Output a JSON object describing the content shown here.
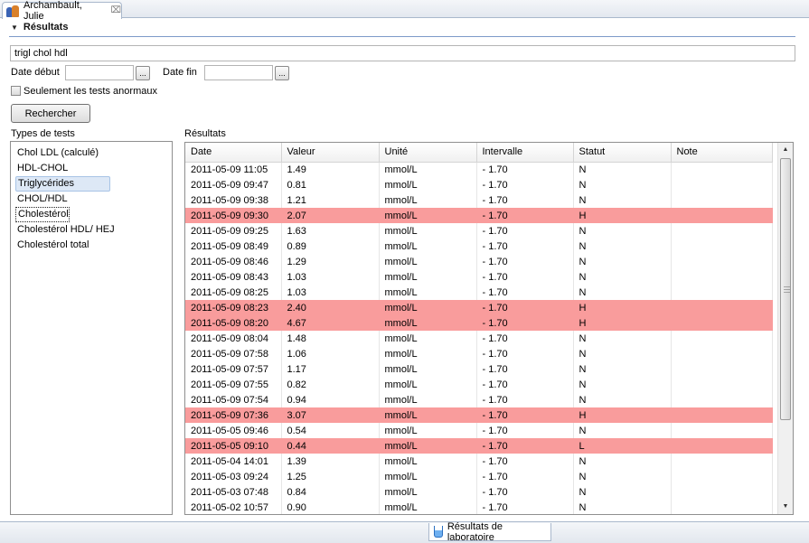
{
  "editor_tab": {
    "title": "Archambault, Julie",
    "close_glyph": "⌧"
  },
  "section": {
    "title": "Résultats"
  },
  "search": {
    "query": "trigl chol hdl",
    "date_start_label": "Date début",
    "date_end_label": "Date fin",
    "date_start_value": "",
    "date_end_value": "",
    "dots_label": "...",
    "abnormal_only_label": "Seulement les tests anormaux",
    "abnormal_only_checked": false,
    "search_button_label": "Rechercher"
  },
  "types": {
    "label": "Types de tests",
    "items": [
      "Chol LDL (calculé)",
      "HDL-CHOL",
      "Triglycérides",
      "CHOL/HDL",
      "Cholestérol",
      "Cholestérol HDL/ HEJ",
      "Cholestérol total"
    ],
    "selected_index": 2,
    "focused_index": 4
  },
  "results": {
    "label": "Résultats",
    "columns": [
      "Date",
      "Valeur",
      "Unité",
      "Intervalle",
      "Statut",
      "Note"
    ],
    "rows": [
      {
        "date": "2011-05-09 11:05",
        "value": "1.49",
        "unit": "mmol/L",
        "range": " - 1.70",
        "status": "N",
        "note": ""
      },
      {
        "date": "2011-05-09 09:47",
        "value": "0.81",
        "unit": "mmol/L",
        "range": " - 1.70",
        "status": "N",
        "note": ""
      },
      {
        "date": "2011-05-09 09:38",
        "value": "1.21",
        "unit": "mmol/L",
        "range": " - 1.70",
        "status": "N",
        "note": ""
      },
      {
        "date": "2011-05-09 09:30",
        "value": "2.07",
        "unit": "mmol/L",
        "range": " - 1.70",
        "status": "H",
        "note": ""
      },
      {
        "date": "2011-05-09 09:25",
        "value": "1.63",
        "unit": "mmol/L",
        "range": " - 1.70",
        "status": "N",
        "note": ""
      },
      {
        "date": "2011-05-09 08:49",
        "value": "0.89",
        "unit": "mmol/L",
        "range": " - 1.70",
        "status": "N",
        "note": ""
      },
      {
        "date": "2011-05-09 08:46",
        "value": "1.29",
        "unit": "mmol/L",
        "range": " - 1.70",
        "status": "N",
        "note": ""
      },
      {
        "date": "2011-05-09 08:43",
        "value": "1.03",
        "unit": "mmol/L",
        "range": " - 1.70",
        "status": "N",
        "note": ""
      },
      {
        "date": "2011-05-09 08:25",
        "value": "1.03",
        "unit": "mmol/L",
        "range": " - 1.70",
        "status": "N",
        "note": ""
      },
      {
        "date": "2011-05-09 08:23",
        "value": "2.40",
        "unit": "mmol/L",
        "range": " - 1.70",
        "status": "H",
        "note": ""
      },
      {
        "date": "2011-05-09 08:20",
        "value": "4.67",
        "unit": "mmol/L",
        "range": " - 1.70",
        "status": "H",
        "note": ""
      },
      {
        "date": "2011-05-09 08:04",
        "value": "1.48",
        "unit": "mmol/L",
        "range": " - 1.70",
        "status": "N",
        "note": ""
      },
      {
        "date": "2011-05-09 07:58",
        "value": "1.06",
        "unit": "mmol/L",
        "range": " - 1.70",
        "status": "N",
        "note": ""
      },
      {
        "date": "2011-05-09 07:57",
        "value": "1.17",
        "unit": "mmol/L",
        "range": " - 1.70",
        "status": "N",
        "note": ""
      },
      {
        "date": "2011-05-09 07:55",
        "value": "0.82",
        "unit": "mmol/L",
        "range": " - 1.70",
        "status": "N",
        "note": ""
      },
      {
        "date": "2011-05-09 07:54",
        "value": "0.94",
        "unit": "mmol/L",
        "range": " - 1.70",
        "status": "N",
        "note": ""
      },
      {
        "date": "2011-05-09 07:36",
        "value": "3.07",
        "unit": "mmol/L",
        "range": " - 1.70",
        "status": "H",
        "note": ""
      },
      {
        "date": "2011-05-05 09:46",
        "value": "0.54",
        "unit": "mmol/L",
        "range": " - 1.70",
        "status": "N",
        "note": ""
      },
      {
        "date": "2011-05-05 09:10",
        "value": "0.44",
        "unit": "mmol/L",
        "range": " - 1.70",
        "status": "L",
        "note": ""
      },
      {
        "date": "2011-05-04 14:01",
        "value": "1.39",
        "unit": "mmol/L",
        "range": " - 1.70",
        "status": "N",
        "note": ""
      },
      {
        "date": "2011-05-03 09:24",
        "value": "1.25",
        "unit": "mmol/L",
        "range": " - 1.70",
        "status": "N",
        "note": ""
      },
      {
        "date": "2011-05-03 07:48",
        "value": "0.84",
        "unit": "mmol/L",
        "range": " - 1.70",
        "status": "N",
        "note": ""
      },
      {
        "date": "2011-05-02 10:57",
        "value": "0.90",
        "unit": "mmol/L",
        "range": " - 1.70",
        "status": "N",
        "note": ""
      }
    ],
    "abnormal_color": "#f99c9c"
  },
  "bottom_tab": {
    "label": "Résultats de laboratoire"
  }
}
